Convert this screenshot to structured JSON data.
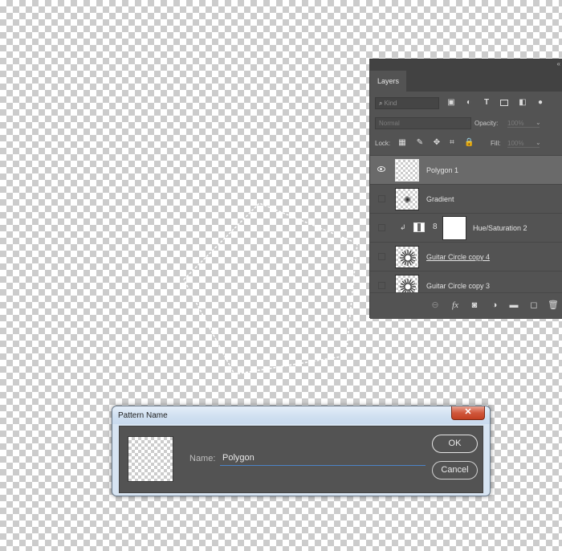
{
  "layers_panel": {
    "tab_label": "Layers",
    "filter_placeholder": "Kind",
    "blend_mode": "Normal",
    "opacity_label": "Opacity:",
    "opacity_value": "100%",
    "lock_label": "Lock:",
    "fill_label": "Fill:",
    "fill_value": "100%",
    "layers": [
      {
        "name": "Polygon 1",
        "visible": true,
        "selected": true,
        "thumb": "transparent"
      },
      {
        "name": "Gradient",
        "visible": false,
        "selected": false,
        "thumb": "gradient"
      },
      {
        "name": "Hue/Saturation 2",
        "visible": false,
        "selected": false,
        "thumb": "adjustment",
        "clipped": true
      },
      {
        "name": "Guitar Circle copy 4",
        "visible": false,
        "selected": false,
        "thumb": "star"
      },
      {
        "name": "Guitar Circle copy 3",
        "visible": false,
        "selected": false,
        "thumb": "star"
      }
    ],
    "footer_icons": [
      "link-icon",
      "fx-icon",
      "mask-icon",
      "adjustment-icon",
      "folder-icon",
      "new-layer-icon",
      "trash-icon"
    ]
  },
  "dialog": {
    "title": "Pattern Name",
    "close_label": "✕",
    "name_label": "Name:",
    "name_value": "Polygon",
    "ok_label": "OK",
    "cancel_label": "Cancel"
  },
  "colors": {
    "panel_bg": "#535353",
    "selected_row": "#6a6a6a",
    "input_underline": "#4c83c6"
  }
}
